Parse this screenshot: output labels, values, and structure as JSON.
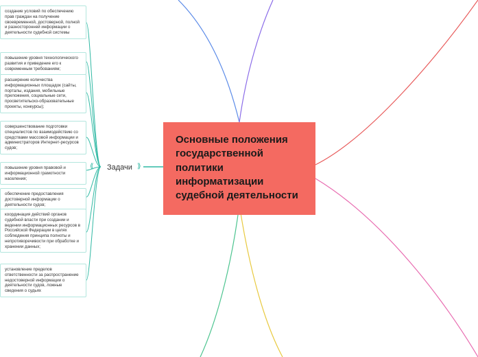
{
  "center": {
    "title": "Основные положения государственной политики информатизации судебной деятельности"
  },
  "branch": {
    "label": "Задачи"
  },
  "leaves": [
    "создание условий по обеспечению прав граждан на получение своевременной, достоверной, полной и разносторонней информации о деятельности судебной системы",
    "повышение уровня технологического развития и приведение его к современным требованиям;",
    "расширение количества информационных площадок (сайты, порталы, издания, мобильные приложения, социальные сети, просветительско-образовательные проекты, конкурсы);",
    "совершенствование подготовки специалистов по взаимодействию со средствами массовой информации и администраторов Интернет-ресурсов судов;",
    "повышение уровня правовой и информационной грамотности населения;",
    "обеспечение предоставления достоверной информации о деятельности судов;",
    "координация действий органов судебной власти при создании и ведении информационных ресурсов в Российской Федерации в целях соблюдения принципа полноты и непротиворечивости при обработке и хранении данных;",
    "установление пределов ответственности за распространение недостоверной информации о деятельности судов, ложные сведения о судьях"
  ],
  "lines": {
    "colors": {
      "teal": "#2fb8a3",
      "green": "#4cc48f",
      "yellow": "#e8c93f",
      "pink": "#e86bb0",
      "red": "#e85a5a",
      "purple": "#8a6be8",
      "blue": "#5a8ae8"
    }
  }
}
